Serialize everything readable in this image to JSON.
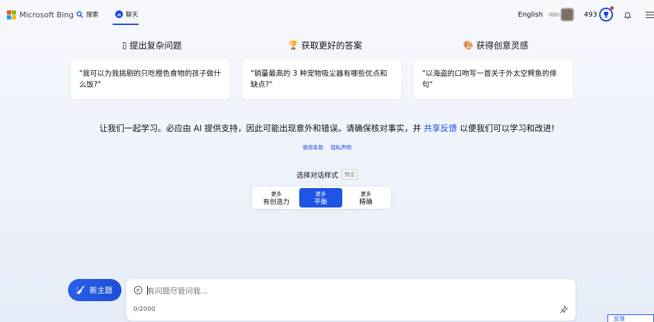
{
  "header": {
    "logo_text": "Microsoft Bing",
    "nav": [
      {
        "label": "搜索",
        "icon": "search-icon"
      },
      {
        "label": "聊天",
        "icon": "chat-icon",
        "active": true
      }
    ],
    "language": "English",
    "points": "493",
    "accent_color": "#174ae4"
  },
  "columns": [
    {
      "icon": "question-icon",
      "title": "提出复杂问题",
      "example": "\"我可以为我挑剔的只吃橙色食物的孩子做什么饭?\""
    },
    {
      "icon": "trophy-face-icon",
      "title": "获取更好的答案",
      "example": "\"销量最高的 3 种宠物吸尘器有哪些优点和缺点?\""
    },
    {
      "icon": "palette-icon",
      "title": "获得创意灵感",
      "example": "\"以海盗的口吻写一首关于外太空鳄鱼的俳句\""
    }
  ],
  "disclaimer": {
    "text_before": "让我们一起学习。必应由 AI 提供支持，因此可能出现意外和错误。请确保核对事实，并 ",
    "link": "共享反馈",
    "text_after": " 以便我们可以学习和改进!"
  },
  "links": {
    "terms": "使用条款",
    "privacy": "隐私声明"
  },
  "style_selector": {
    "label": "选择对话样式",
    "badge": "预览",
    "options": [
      {
        "prefix": "更多",
        "label": "有创造力",
        "selected": false
      },
      {
        "prefix": "更多",
        "label": "平衡",
        "selected": true
      },
      {
        "prefix": "更多",
        "label": "精确",
        "selected": false
      }
    ]
  },
  "composer": {
    "new_topic_label": "新主题",
    "placeholder": "有问题尽管问我...",
    "counter": "0/2000"
  },
  "feedback_tab": "反馈"
}
